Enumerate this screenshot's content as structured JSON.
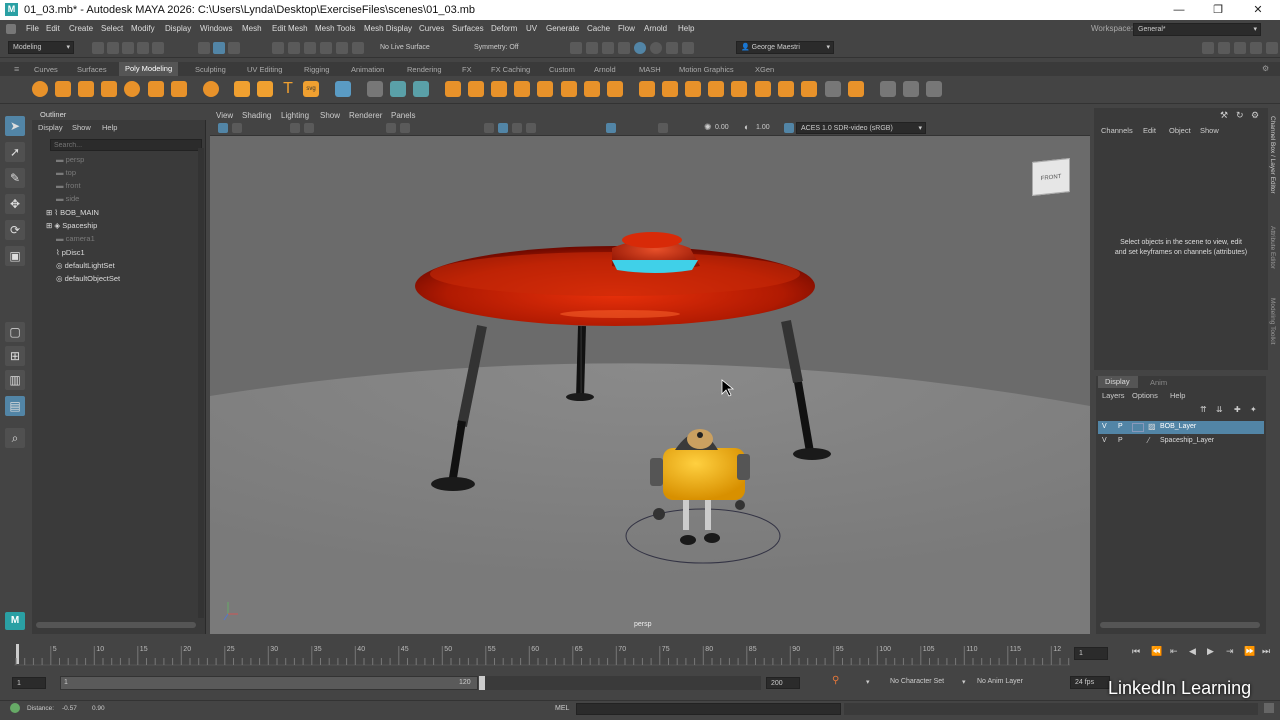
{
  "title": {
    "logo": "M",
    "text": "01_03.mb* - Autodesk MAYA 2026: C:\\Users\\Lynda\\Desktop\\ExerciseFiles\\scenes\\01_03.mb",
    "min": "—",
    "max": "❐",
    "close": "✕"
  },
  "menu": [
    "File",
    "Edit",
    "Create",
    "Select",
    "Modify",
    "Display",
    "Windows",
    "Mesh",
    "Edit Mesh",
    "Mesh Tools",
    "Mesh Display",
    "Curves",
    "Surfaces",
    "Deform",
    "UV",
    "Generate",
    "Cache",
    "Flow",
    "Arnold",
    "Help"
  ],
  "workspace": {
    "label": "Workspace:",
    "value": "General*"
  },
  "status": {
    "mode": "Modeling",
    "live": "No Live Surface",
    "symmetry": "Symmetry: Off",
    "user": "George Maestri"
  },
  "shelf_tabs": [
    "Curves",
    "Surfaces",
    "Poly Modeling",
    "Sculpting",
    "UV Editing",
    "Rigging",
    "Animation",
    "Rendering",
    "FX",
    "FX Caching",
    "Custom",
    "Arnold",
    "MASH",
    "Motion Graphics",
    "XGen"
  ],
  "outliner": {
    "title": "Outliner",
    "menu": [
      "Display",
      "Show",
      "Help"
    ],
    "search": "Search...",
    "items": [
      {
        "label": "persp",
        "dim": true
      },
      {
        "label": "top",
        "dim": true
      },
      {
        "label": "front",
        "dim": true
      },
      {
        "label": "side",
        "dim": true
      },
      {
        "label": "BOB_MAIN",
        "dim": false
      },
      {
        "label": "Spaceship",
        "dim": false
      },
      {
        "label": "camera1",
        "dim": true
      },
      {
        "label": "pDisc1",
        "dim": false
      },
      {
        "label": "defaultLightSet",
        "dim": false
      },
      {
        "label": "defaultObjectSet",
        "dim": false
      }
    ]
  },
  "viewport": {
    "menu": [
      "View",
      "Shading",
      "Lighting",
      "Show",
      "Renderer",
      "Panels"
    ],
    "exposure": "0.00",
    "gamma": "1.00",
    "colorspace": "ACES 1.0 SDR-video (sRGB)",
    "camera": "persp",
    "viewcube": "FRONT"
  },
  "channelbox": {
    "menu": [
      "Channels",
      "Edit",
      "Object",
      "Show"
    ],
    "hint": "Select objects in the scene to view, edit and set keyframes on channels (attributes)"
  },
  "layers": {
    "tabs": [
      "Display",
      "Anim"
    ],
    "menu": [
      "Layers",
      "Options",
      "Help"
    ],
    "items": [
      {
        "v": "V",
        "p": "P",
        "name": "BOB_Layer",
        "selected": true
      },
      {
        "v": "V",
        "p": "P",
        "name": "Spaceship_Layer",
        "selected": false
      }
    ]
  },
  "right_tabs": [
    "Channel Box / Layer Editor",
    "Attribute Editor",
    "Modeling Toolkit"
  ],
  "time": {
    "ticks": [
      "5",
      "10",
      "15",
      "20",
      "25",
      "30",
      "35",
      "40",
      "45",
      "50",
      "55",
      "60",
      "65",
      "70",
      "75",
      "80",
      "85",
      "90",
      "95",
      "100",
      "105",
      "110",
      "115",
      "12"
    ],
    "current": "1",
    "range_start": "1",
    "range_inner_start": "1",
    "range_inner_end": "120",
    "range_end": "200",
    "charset": "No Character Set",
    "animlayer": "No Anim Layer",
    "fps": "24 fps"
  },
  "cmd": {
    "distance_label": "Distance:",
    "dx": "-0.57",
    "dy": "0.90",
    "lang": "MEL"
  },
  "watermark": "LinkedIn Learning"
}
